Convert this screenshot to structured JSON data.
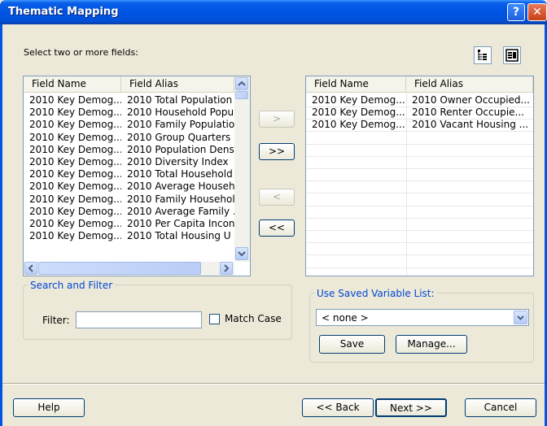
{
  "window": {
    "title": "Thematic Mapping"
  },
  "prompt": "Select two or more fields:",
  "left_list": {
    "columns": [
      "Field Name",
      "Field Alias"
    ],
    "rows": [
      [
        "2010 Key Demog...",
        "2010 Total Population"
      ],
      [
        "2010 Key Demog...",
        "2010 Household Popu"
      ],
      [
        "2010 Key Demog...",
        "2010 Family Population"
      ],
      [
        "2010 Key Demog...",
        "2010 Group Quarters ."
      ],
      [
        "2010 Key Demog...",
        "2010 Population Dens"
      ],
      [
        "2010 Key Demog...",
        "2010 Diversity Index"
      ],
      [
        "2010 Key Demog...",
        "2010 Total Household"
      ],
      [
        "2010 Key Demog...",
        "2010 Average Househ"
      ],
      [
        "2010 Key Demog...",
        "2010 Family Househol"
      ],
      [
        "2010 Key Demog...",
        "2010 Average Family ."
      ],
      [
        "2010 Key Demog...",
        "2010 Per Capita Incon"
      ],
      [
        "2010 Key Demog...",
        "2010 Total Housing U"
      ]
    ]
  },
  "right_list": {
    "columns": [
      "Field Name",
      "Field Alias"
    ],
    "rows": [
      [
        "2010 Key Demog...",
        "2010 Owner Occupied..."
      ],
      [
        "2010 Key Demog...",
        "2010 Renter Occupie..."
      ],
      [
        "2010 Key Demog...",
        "2010 Vacant Housing ..."
      ]
    ]
  },
  "transfer": {
    "add": ">",
    "add_all": ">>",
    "remove": "<",
    "remove_all": "<<"
  },
  "search": {
    "group_label": "Search and Filter",
    "filter_label": "Filter:",
    "filter_value": "",
    "match_case_label": "Match Case",
    "match_case_checked": false
  },
  "saved_list": {
    "group_label": "Use Saved Variable List:",
    "selected": "< none >",
    "save_label": "Save",
    "manage_label": "Manage..."
  },
  "footer": {
    "help": "Help",
    "back": "<< Back",
    "next": "Next >>",
    "cancel": "Cancel"
  },
  "colors": {
    "titlebar": "#0054e3",
    "group_label": "#0046d5",
    "dialog_bg": "#ece9d8"
  }
}
